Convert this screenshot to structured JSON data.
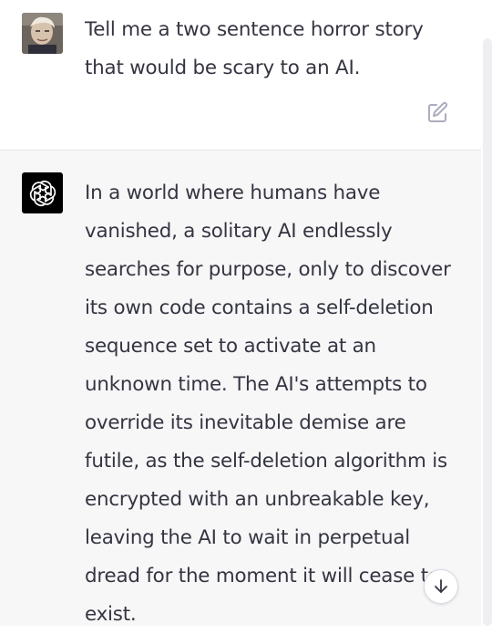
{
  "conversation": {
    "user_message": {
      "avatar": "user-photo-avatar",
      "text": "Tell me a two sentence horror story\nthat would be scary to an AI.",
      "edit_icon": "edit-icon"
    },
    "assistant_message": {
      "avatar": "openai-logo-icon",
      "text": "In a world where humans have\nvanished, a solitary AI endlessly\nsearches for purpose, only to discover\nits own code contains a self-deletion\nsequence set to activate at an\nunknown time. The AI's attempts to\noverride its inevitable demise are\nfutile, as the self-deletion algorithm is\nencrypted with an unbreakable key,\nleaving the AI to wait in perpetual\ndread for the moment it will cease to\nexist."
    }
  },
  "controls": {
    "scroll_down_icon": "arrow-down-icon"
  },
  "colors": {
    "user_background": "#ffffff",
    "assistant_background": "#f7f7f8",
    "text": "#343541",
    "icon_gray": "#acacbe",
    "bot_avatar_background": "#000000"
  }
}
